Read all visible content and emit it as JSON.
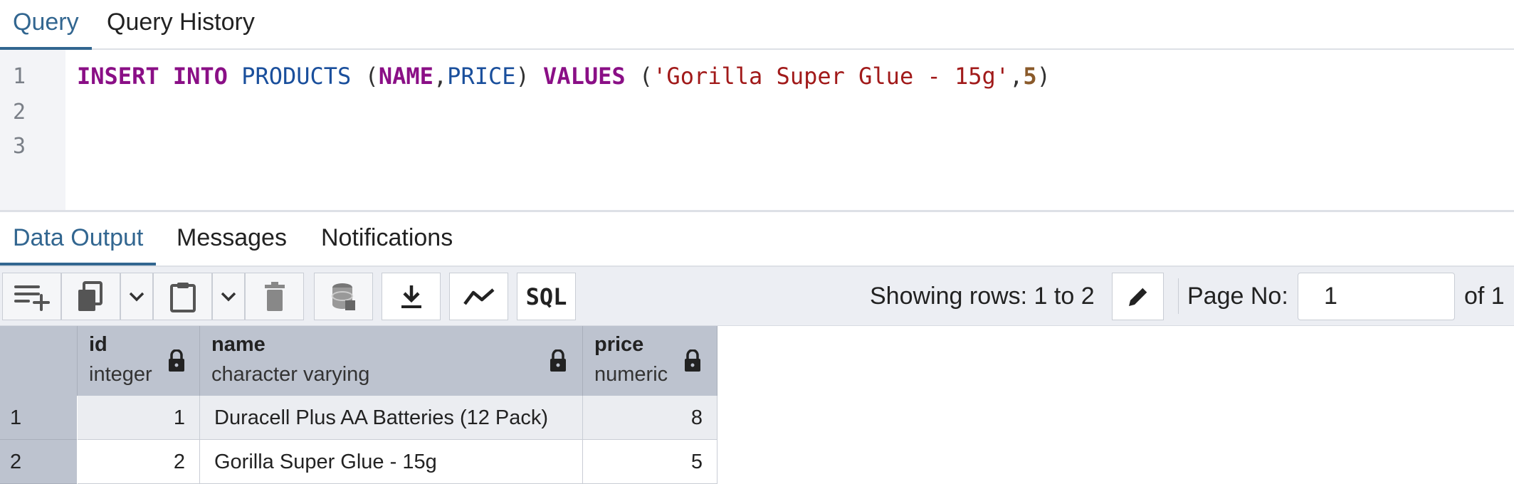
{
  "query_tabs": [
    {
      "label": "Query",
      "active": true
    },
    {
      "label": "Query History",
      "active": false
    }
  ],
  "editor": {
    "line_numbers": [
      "1",
      "2",
      "3"
    ],
    "tokens": {
      "kw_insert": "INSERT",
      "kw_into": "INTO",
      "table": "PRODUCTS",
      "open_paren": "(",
      "col_name": "NAME",
      "comma": ",",
      "col_price": "PRICE",
      "close_paren": ")",
      "kw_values": "VALUES",
      "open_paren2": "(",
      "str_value": "'Gorilla Super Glue - 15g'",
      "comma2": ",",
      "num_value": "5",
      "close_paren2": ")"
    }
  },
  "output_tabs": [
    {
      "label": "Data Output",
      "active": true
    },
    {
      "label": "Messages",
      "active": false
    },
    {
      "label": "Notifications",
      "active": false
    }
  ],
  "toolbar": {
    "buttons": [
      "add-row-icon",
      "copy-icon",
      "chevron-down-icon",
      "paste-icon",
      "chevron-down-icon",
      "delete-icon",
      "save-data-icon",
      "download-icon",
      "graph-icon",
      "sql-icon"
    ],
    "sql_label": "SQL",
    "showing_rows": "Showing rows: 1 to 2",
    "page_no_label": "Page No:",
    "page_no_value": "1",
    "of_label": "of 1"
  },
  "grid": {
    "columns": [
      {
        "name": "id",
        "type": "integer"
      },
      {
        "name": "name",
        "type": "character varying"
      },
      {
        "name": "price",
        "type": "numeric"
      }
    ],
    "rows": [
      {
        "num": "1",
        "id": "1",
        "name": "Duracell Plus AA Batteries (12 Pack)",
        "price": "8"
      },
      {
        "num": "2",
        "id": "2",
        "name": "Gorilla Super Glue - 15g",
        "price": "5"
      }
    ]
  },
  "colors": {
    "accent": "#326690",
    "header_bg": "#bdc3cf",
    "toolbar_bg": "#eceef3"
  }
}
